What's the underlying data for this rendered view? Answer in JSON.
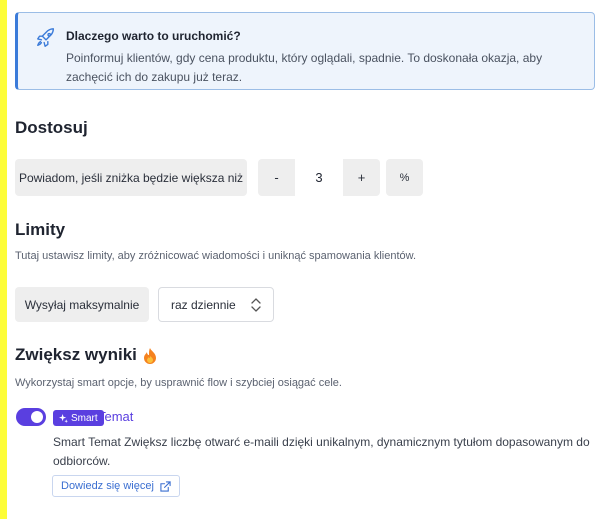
{
  "info": {
    "icon": "rocket-icon",
    "title": "Dlaczego warto to uruchomić?",
    "description": "Poinformuj klientów, gdy cena produktu, który oglądali, spadnie. To doskonała okazja, aby zachęcić ich do zakupu już teraz."
  },
  "customize": {
    "heading": "Dostosuj",
    "condition_label": "Powiadom, jeśli zniżka będzie większa niż",
    "minus_label": "-",
    "value": "3",
    "plus_label": "+",
    "unit": "%"
  },
  "limits": {
    "heading": "Limity",
    "description": "Tutaj ustawisz limity, aby zróżnicować wiadomości i uniknąć spamowania klientów.",
    "send_label": "Wysyłaj maksymalnie",
    "frequency_value": "raz dziennie"
  },
  "boost": {
    "heading": "Zwiększ wyniki",
    "icon": "fire-icon",
    "description": "Wykorzystaj smart opcje, by usprawnić flow i szybciej osiągać cele.",
    "toggle_on": true,
    "badge_label": "Smart",
    "option_title": "Temat",
    "option_description": "Smart Temat Zwiększ liczbę otwarć e-maili dzięki unikalnym, dynamicznym tytułom dopasowanym do odbiorców.",
    "learn_more": "Dowiedz się więcej"
  },
  "colors": {
    "accent": "#5a3fe0",
    "info_border": "#3b7bd9",
    "background_edge": "#fdfd38"
  }
}
